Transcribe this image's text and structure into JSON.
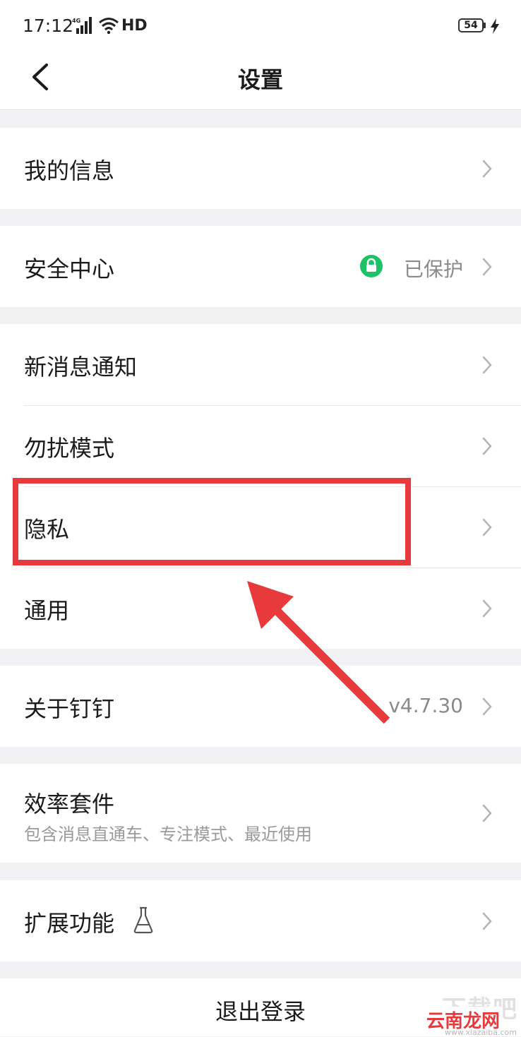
{
  "status_bar": {
    "time": "17:12",
    "network": "4G",
    "hd": "HD",
    "battery": "54"
  },
  "navbar": {
    "title": "设置"
  },
  "groups": [
    {
      "items": [
        {
          "label": "我的信息"
        }
      ]
    },
    {
      "items": [
        {
          "label": "安全中心",
          "value": "已保护"
        }
      ]
    },
    {
      "items": [
        {
          "label": "新消息通知"
        },
        {
          "label": "勿扰模式"
        },
        {
          "label": "隐私"
        },
        {
          "label": "通用"
        }
      ]
    },
    {
      "items": [
        {
          "label": "关于钉钉",
          "value": "v4.7.30"
        }
      ]
    },
    {
      "items": [
        {
          "label": "效率套件",
          "sub": "包含消息直通车、专注模式、最近使用"
        }
      ]
    },
    {
      "items": [
        {
          "label": "扩展功能"
        }
      ]
    }
  ],
  "logout": {
    "label": "退出登录"
  },
  "watermark": {
    "line1": "下载吧",
    "line2": "云南龙网",
    "line3": "www.xiazaiba.com"
  },
  "colors": {
    "accent_green": "#1bc266",
    "annotation_red": "#e8393d",
    "background": "#f2f2f4"
  }
}
